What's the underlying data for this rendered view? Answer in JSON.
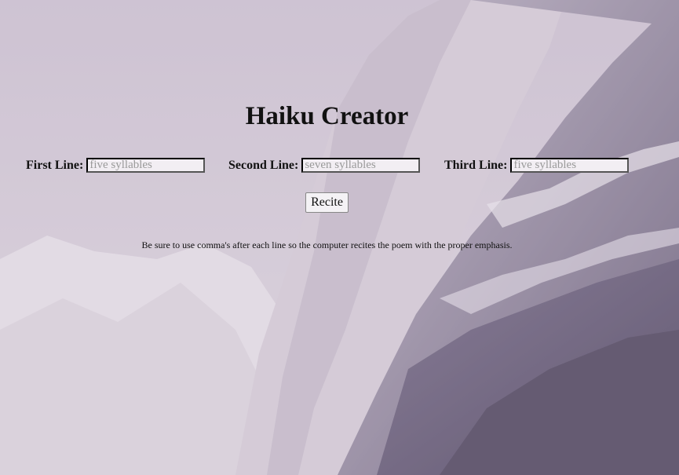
{
  "page": {
    "title": "Haiku Creator",
    "tip": "Be sure to use comma's after each line so the computer recites the poem with the proper emphasis."
  },
  "form": {
    "first": {
      "label": "First Line:",
      "value": "",
      "placeholder": "five syllables"
    },
    "second": {
      "label": "Second Line:",
      "value": "",
      "placeholder": "seven syllables"
    },
    "third": {
      "label": "Third Line:",
      "value": "",
      "placeholder": "five syllables"
    },
    "recite_label": "Recite"
  },
  "colors": {
    "background_tint": "#d9cfdb",
    "mountain_dark": "#4a3f5c"
  }
}
